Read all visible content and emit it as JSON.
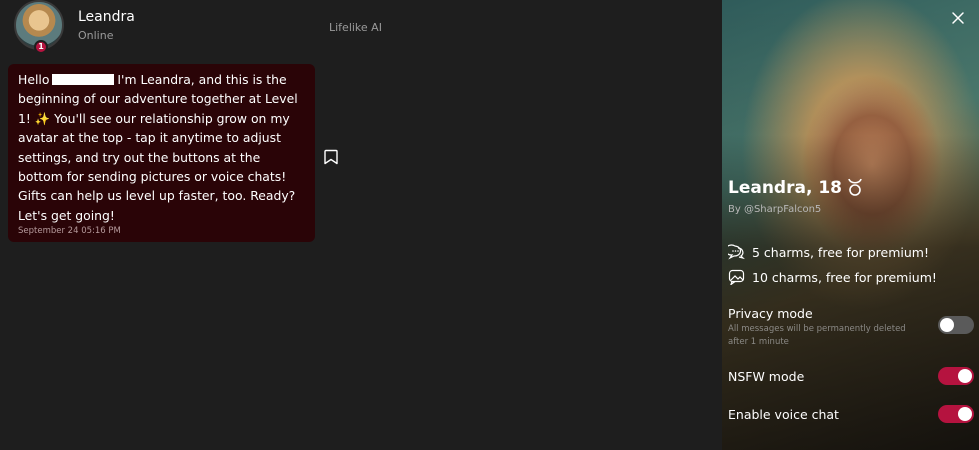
{
  "header": {
    "character_name": "Leandra",
    "status": "Online",
    "level_badge": "1",
    "brand": "Lifelike AI"
  },
  "message": {
    "part1": "Hello",
    "part2": "I'm Leandra, and this is the beginning of our adventure together at Level 1! ✨ You'll see our relationship grow on my avatar at the top - tap it anytime to adjust settings, and try out the buttons at the bottom for sending pictures or voice chats! Gifts can help us level up faster, too. Ready? Let's get going!",
    "timestamp": "September 24 05:16 PM"
  },
  "profile": {
    "name_age": "Leandra, 18",
    "creator": "By @SharpFalcon5",
    "charms": [
      {
        "icon": "chat-bubbles-icon",
        "text": "5 charms, free for premium!"
      },
      {
        "icon": "image-chat-icon",
        "text": "10 charms, free for premium!"
      }
    ],
    "settings": {
      "privacy_label": "Privacy mode",
      "privacy_desc": "All messages will be permanently deleted after 1 minute",
      "privacy_on": false,
      "nsfw_label": "NSFW mode",
      "nsfw_on": true,
      "voice_label": "Enable voice chat",
      "voice_on": true
    }
  },
  "colors": {
    "background": "#1e1e1e",
    "bubble": "#2a0407",
    "accent": "#b5133f",
    "toggle_off": "#5a5a5a"
  }
}
